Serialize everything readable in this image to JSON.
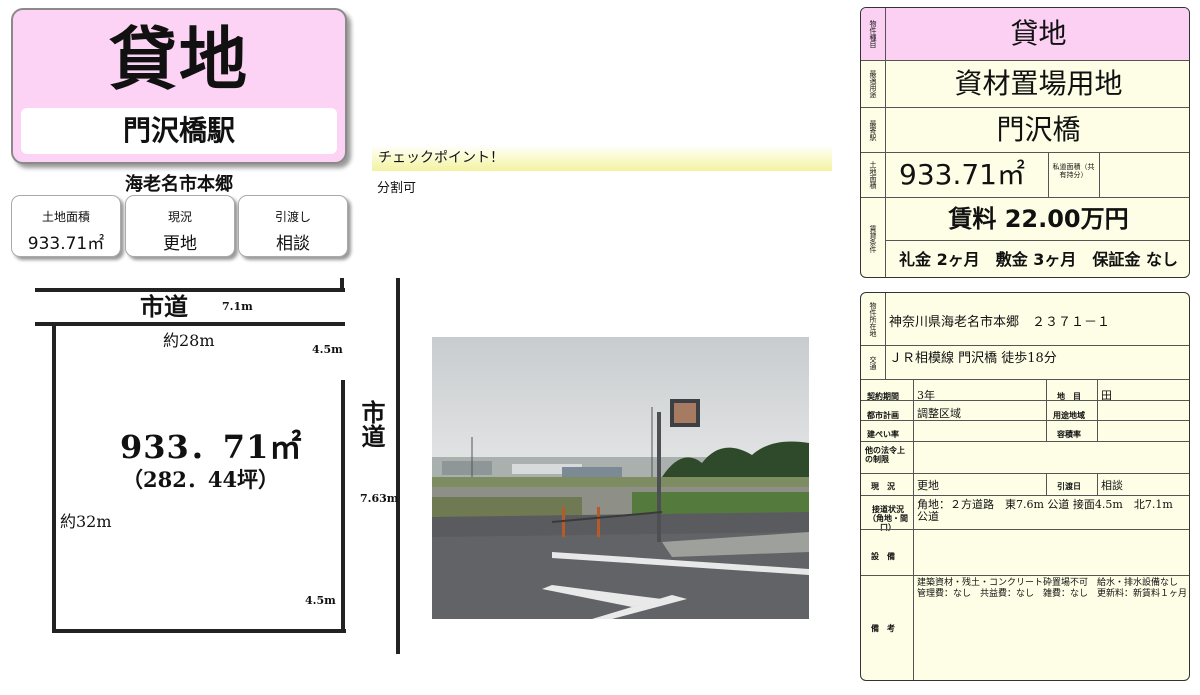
{
  "title_card": {
    "type": "貸地",
    "station": "門沢橋駅"
  },
  "city": "海老名市本郷",
  "info_cards": [
    {
      "label": "土地面積",
      "value": "933.71㎡"
    },
    {
      "label": "現況",
      "value": "更地"
    },
    {
      "label": "引渡し",
      "value": "相談"
    }
  ],
  "checkpoint": {
    "title": "チェックポイント！",
    "text": "分割可"
  },
  "map": {
    "road_top": "市道",
    "road_top_width": "7.1m",
    "top_length": "約28m",
    "frontage_top": "4.5m",
    "road_right": "市道",
    "road_right_width": "7.63m",
    "area": "933．71㎡",
    "tsubo": "（282．44坪）",
    "side_length": "約32m",
    "frontage_bottom": "4.5m"
  },
  "summary": {
    "type_label": "物件種目",
    "type": "貸地",
    "use_label": "最適用途",
    "use": "資材置場用地",
    "station_label": "最寄駅",
    "station": "門沢橋",
    "area_label": "土地面積",
    "area": "933.71㎡",
    "private_road_label": "私道面積（共有持分）",
    "rent_label": "賃貸条件",
    "rent": "賃料 22.00万円",
    "terms": "礼金 2ヶ月　敷金 3ヶ月　保証金 なし"
  },
  "details": {
    "location_label": "物件所在地",
    "location": "神奈川県海老名市本郷　２３７１－１",
    "transport_label": "交通",
    "transport": "ＪＲ相模線 門沢橋 徒歩18分",
    "contract_label": "契約期間",
    "contract": "3年",
    "land_label": "地　目",
    "land": "田",
    "city_plan_label": "都市計画",
    "city_plan": "調整区域",
    "zoning_label": "用途地域",
    "zoning": "",
    "bcr_label": "建ぺい率",
    "bcr": "",
    "far_label": "容積率",
    "far": "",
    "other_law_label": "他の法令上の制限",
    "other_law": "",
    "status_label": "現　況",
    "status": "更地",
    "handover_label": "引渡日",
    "handover": "相談",
    "road_label": "接道状況（角地・間口）",
    "road": "角地：２方道路　東7.6m 公道 接面4.5m　北7.1m 公道",
    "facility_label": "設　備",
    "facility": "",
    "notes_label": "備　考",
    "notes": "建築資材・残土・コンクリート砕置場不可　給水・排水設備なし　管理費：なし　共益費：なし　雑費：なし　更新料：新賃料１ヶ月"
  },
  "colors": {
    "pink": "#fbd0f2",
    "panel_bg": "#fefee6",
    "checkpoint": "#f2f2a0"
  }
}
